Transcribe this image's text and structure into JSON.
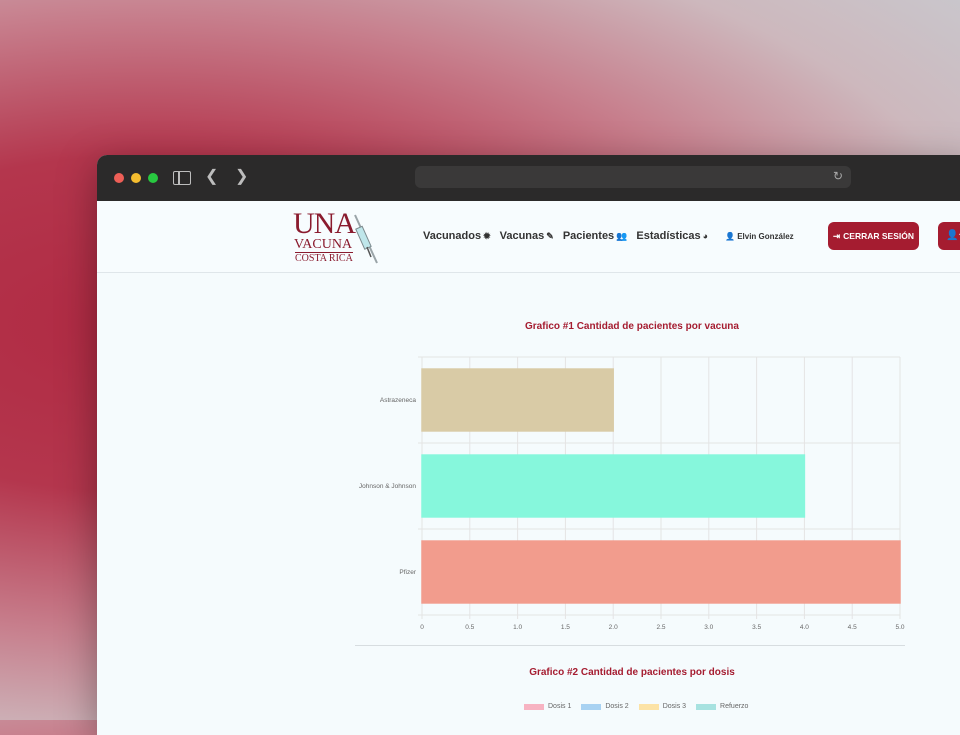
{
  "navbar": {
    "logo": {
      "line1": "UNA",
      "line2": "VACUNA",
      "line3": "COSTA RICA"
    },
    "items": [
      {
        "label": "Vacunados",
        "icon": "virus-icon",
        "glyph": "✹"
      },
      {
        "label": "Vacunas",
        "icon": "syringe-icon",
        "glyph": "✎"
      },
      {
        "label": "Pacientes",
        "icon": "users-icon",
        "glyph": "👥"
      },
      {
        "label": "Estadísticas",
        "icon": "pie-chart-icon",
        "glyph": "◕"
      }
    ],
    "user": {
      "name": "Elvin González",
      "icon": "user-icon"
    },
    "logout_label": "CERRAR SESIÓN",
    "logout_icon": "sign-out-icon"
  },
  "chart1": {
    "title": "Grafico #1 Cantidad de pacientes por vacuna"
  },
  "chart2": {
    "title": "Grafico #2 Cantidad de pacientes por dosis",
    "legend": [
      {
        "label": "Dosis 1",
        "color": "#f7b3c2"
      },
      {
        "label": "Dosis 2",
        "color": "#a8d2f2"
      },
      {
        "label": "Dosis 3",
        "color": "#fce3a6"
      },
      {
        "label": "Refuerzo",
        "color": "#a7e2e0"
      }
    ]
  },
  "chart_data": [
    {
      "type": "bar",
      "orientation": "horizontal",
      "title": "Grafico #1 Cantidad de pacientes por vacuna",
      "categories": [
        "Astrazeneca",
        "Johnson & Johnson",
        "Pfizer"
      ],
      "values": [
        2,
        4,
        5
      ],
      "colors": [
        "#d9cba6",
        "#86f7dc",
        "#f29c8d"
      ],
      "xlim": [
        0,
        5
      ],
      "xticks": [
        "0",
        "0.5",
        "1.0",
        "1.5",
        "2.0",
        "2.5",
        "3.0",
        "3.5",
        "4.0",
        "4.5",
        "5.0"
      ],
      "grid": true
    }
  ]
}
